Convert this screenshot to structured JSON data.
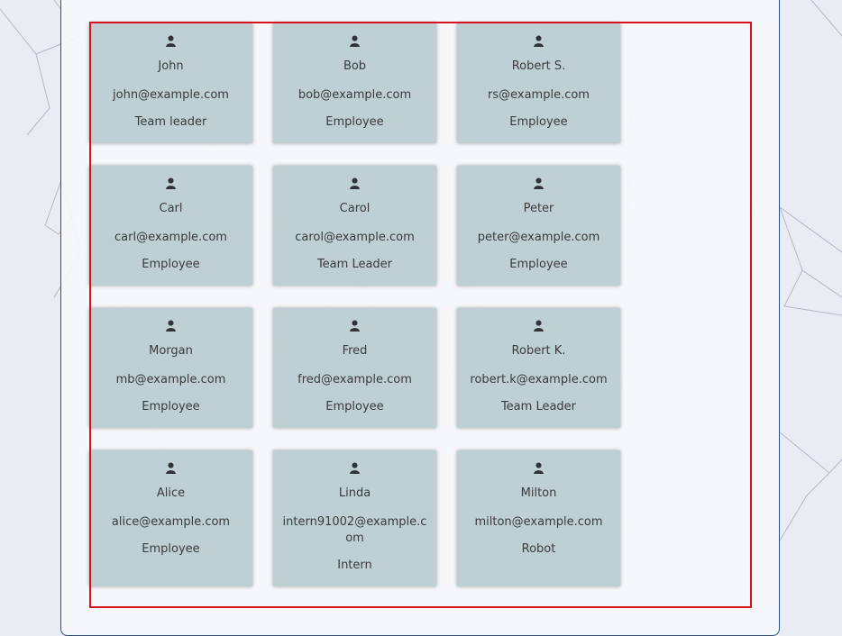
{
  "icon": "user-icon",
  "colors": {
    "card": "#bfd0d5",
    "selection": "#d8131b",
    "panel_border": "#2b4f86"
  },
  "users": [
    {
      "name": "John",
      "email": "john@example.com",
      "role": "Team leader"
    },
    {
      "name": "Bob",
      "email": "bob@example.com",
      "role": "Employee"
    },
    {
      "name": "Robert S.",
      "email": "rs@example.com",
      "role": "Employee"
    },
    {
      "name": "Carl",
      "email": "carl@example.com",
      "role": "Employee"
    },
    {
      "name": "Carol",
      "email": "carol@example.com",
      "role": "Team Leader"
    },
    {
      "name": "Peter",
      "email": "peter@example.com",
      "role": "Employee"
    },
    {
      "name": "Morgan",
      "email": "mb@example.com",
      "role": "Employee"
    },
    {
      "name": "Fred",
      "email": "fred@example.com",
      "role": "Employee"
    },
    {
      "name": "Robert K.",
      "email": "robert.k@example.com",
      "role": "Team Leader"
    },
    {
      "name": "Alice",
      "email": "alice@example.com",
      "role": "Employee"
    },
    {
      "name": "Linda",
      "email": "intern91002@example.com",
      "role": "Intern"
    },
    {
      "name": "Milton",
      "email": "milton@example.com",
      "role": "Robot"
    }
  ]
}
